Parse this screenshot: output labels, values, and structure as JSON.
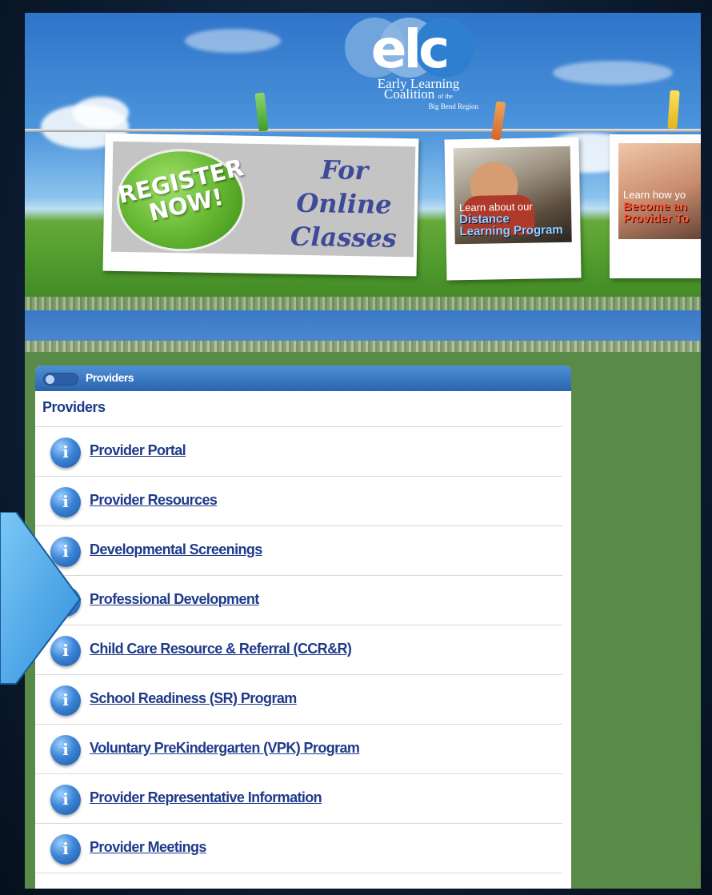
{
  "logo": {
    "mark": "elc",
    "line1": "Early Learning",
    "line2": "Coalition",
    "line2_small": "of the",
    "line3": "Big Bend Region"
  },
  "banner": {
    "register_badge": [
      "REGISTER",
      "NOW!"
    ],
    "register_copy": [
      "For",
      "Online",
      "Classes"
    ],
    "distance_card": [
      "Learn about our",
      "Distance",
      "Learning Program"
    ],
    "provider_card": [
      "Learn how yo",
      "Become an",
      "Provider To"
    ]
  },
  "panel": {
    "header": "Providers",
    "section_title": "Providers",
    "items": [
      {
        "label": "Provider Portal"
      },
      {
        "label": "Provider Resources"
      },
      {
        "label": "Developmental Screenings"
      },
      {
        "label": "Professional Development"
      },
      {
        "label": "Child Care Resource & Referral (CCR&R)"
      },
      {
        "label": "School Readiness (SR) Program"
      },
      {
        "label": "Voluntary PreKindergarten (VPK) Program"
      },
      {
        "label": "Provider Representative Information"
      },
      {
        "label": "Provider Meetings"
      }
    ]
  },
  "colors": {
    "link": "#1f3a8a",
    "panel_header": "#2b64ad",
    "background_green": "#5a8a47",
    "arrow": "#4aa8e8"
  },
  "icons": {
    "info": "info-icon",
    "pointer": "arrow-pointer"
  }
}
